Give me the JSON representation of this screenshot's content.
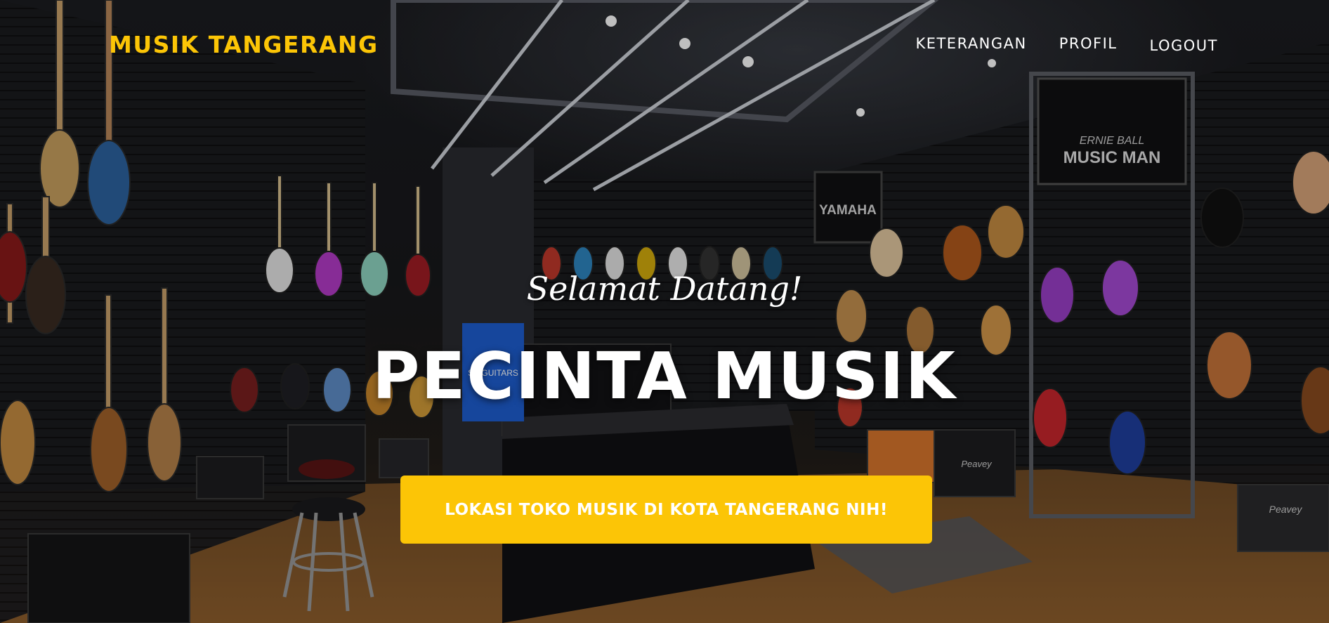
{
  "navbar": {
    "brand": "MUSIK TANGERANG",
    "links": [
      "KETERANGAN",
      "PROFIL",
      "LOGOUT"
    ]
  },
  "masthead": {
    "subheading": "Selamat Datang!",
    "heading": "PECINTA MUSIK",
    "cta_label": "LOKASI TOKO MUSIK DI KOTA TANGERANG NIH!"
  },
  "background": {
    "brand_signs": [
      "YAMAHA",
      "ERNIE BALL",
      "MUSIC MAN"
    ],
    "amp_badges": [
      "Peavey",
      "Peavey"
    ],
    "display_screen": "SS GUITARS"
  },
  "colors": {
    "accent": "#fcc506",
    "text": "#ffffff",
    "wall": "#17181b",
    "floor": "#8a5a2b"
  }
}
